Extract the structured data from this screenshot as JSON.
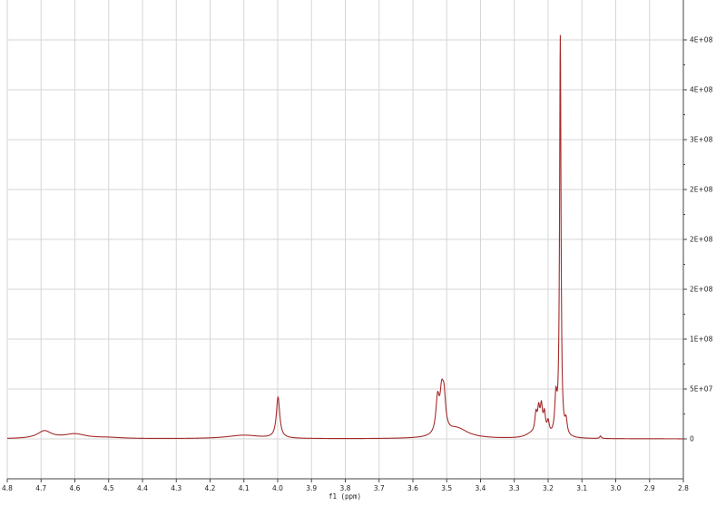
{
  "chart_data": {
    "type": "line",
    "title": "",
    "xlabel": "f1 (ppm)",
    "ylabel": "",
    "x_reversed": true,
    "xlim": [
      4.8,
      2.8
    ],
    "ylim": [
      -8000000,
      88000000
    ],
    "x_ticks": [
      4.8,
      4.7,
      4.6,
      4.5,
      4.4,
      4.3,
      4.2,
      4.1,
      4.0,
      3.9,
      3.8,
      3.7,
      3.6,
      3.5,
      3.4,
      3.3,
      3.2,
      3.1,
      3.0,
      2.9,
      2.8
    ],
    "x_tick_labels": [
      "4.8",
      "4.7",
      "4.6",
      "4.5",
      "4.4",
      "4.3",
      "4.2",
      "4.1",
      "4.0",
      "3.9",
      "3.8",
      "3.7",
      "3.6",
      "3.5",
      "3.4",
      "3.3",
      "3.2",
      "3.1",
      "3.0",
      "2.9",
      "2.8"
    ],
    "y_ticks": [
      0,
      10000000,
      20000000,
      30000000,
      40000000,
      50000000,
      60000000,
      70000000,
      80000000
    ],
    "y_tick_labels": [
      "0",
      "5E+07",
      "1E+08",
      "2E+08",
      "2E+08",
      "2E+08",
      "3E+08",
      "4E+08",
      "4E+08"
    ],
    "y_axis_side": "right",
    "grid": true,
    "colors": {
      "line": "#a52a2a",
      "grid": "#d6d6d6",
      "axis": "#444444"
    },
    "series": [
      {
        "peaks": [
          {
            "center": 4.69,
            "height": 1500000,
            "width": 0.025
          },
          {
            "center": 4.6,
            "height": 900000,
            "width": 0.04
          },
          {
            "center": 4.5,
            "height": 200000,
            "width": 0.05
          },
          {
            "center": 4.1,
            "height": 700000,
            "width": 0.06
          },
          {
            "center": 3.999,
            "height": 8200000,
            "width": 0.006
          },
          {
            "center": 3.527,
            "height": 6800000,
            "width": 0.006
          },
          {
            "center": 3.515,
            "height": 6800000,
            "width": 0.006
          },
          {
            "center": 3.508,
            "height": 6500000,
            "width": 0.006
          },
          {
            "center": 3.47,
            "height": 2000000,
            "width": 0.04
          },
          {
            "center": 3.25,
            "height": 800000,
            "width": 0.02
          },
          {
            "center": 3.236,
            "height": 3800000,
            "width": 0.004
          },
          {
            "center": 3.228,
            "height": 4600000,
            "width": 0.004
          },
          {
            "center": 3.22,
            "height": 5200000,
            "width": 0.004
          },
          {
            "center": 3.211,
            "height": 4000000,
            "width": 0.004
          },
          {
            "center": 3.2,
            "height": 2500000,
            "width": 0.004
          },
          {
            "center": 3.177,
            "height": 7200000,
            "width": 0.004
          },
          {
            "center": 3.164,
            "height": 80000000,
            "width": 0.0025
          },
          {
            "center": 3.147,
            "height": 2800000,
            "width": 0.004
          },
          {
            "center": 3.045,
            "height": 500000,
            "width": 0.003
          }
        ]
      }
    ]
  }
}
